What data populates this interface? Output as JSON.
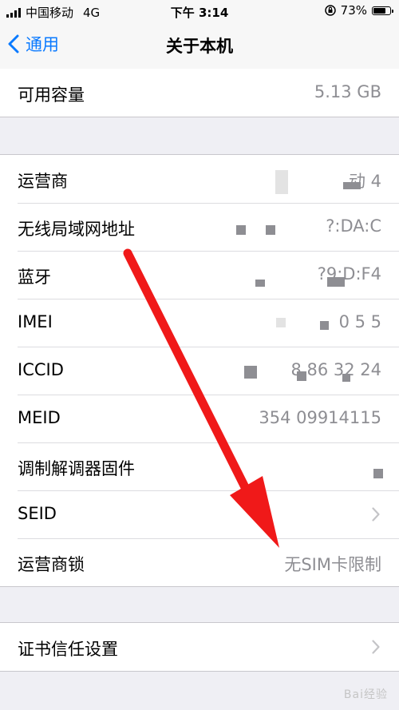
{
  "status_bar": {
    "carrier": "中国移动",
    "network": "4G",
    "time": "下午 3:14",
    "battery_percent": "73%",
    "battery_level": 0.73
  },
  "nav": {
    "back_label": "通用",
    "title": "关于本机"
  },
  "storage": {
    "label": "可用容量",
    "value": "5.13 GB"
  },
  "info_rows": [
    {
      "label": "运营商",
      "value": "动 4"
    },
    {
      "label": "无线局域网地址",
      "value": "?:DA:C"
    },
    {
      "label": "蓝牙",
      "value": "?9:D:F4"
    },
    {
      "label": "IMEI",
      "value": "0 5 5"
    },
    {
      "label": "ICCID",
      "value": "8 86 32 24"
    },
    {
      "label": "MEID",
      "value": "354 09914115"
    },
    {
      "label": "调制解调器固件",
      "value": ""
    },
    {
      "label": "SEID",
      "value": ""
    },
    {
      "label": "运营商锁",
      "value": "无SIM卡限制"
    }
  ],
  "cert": {
    "label": "证书信任设置"
  },
  "watermark": "Bai经验",
  "colors": {
    "accent": "#0a7aff",
    "annotation_arrow": "#f01919",
    "background": "#efeff4",
    "secondary_text": "#8e8e93"
  },
  "icons": [
    "signal-icon",
    "orientation-lock-icon",
    "battery-icon",
    "back-chevron-icon",
    "chevron-right-icon"
  ]
}
